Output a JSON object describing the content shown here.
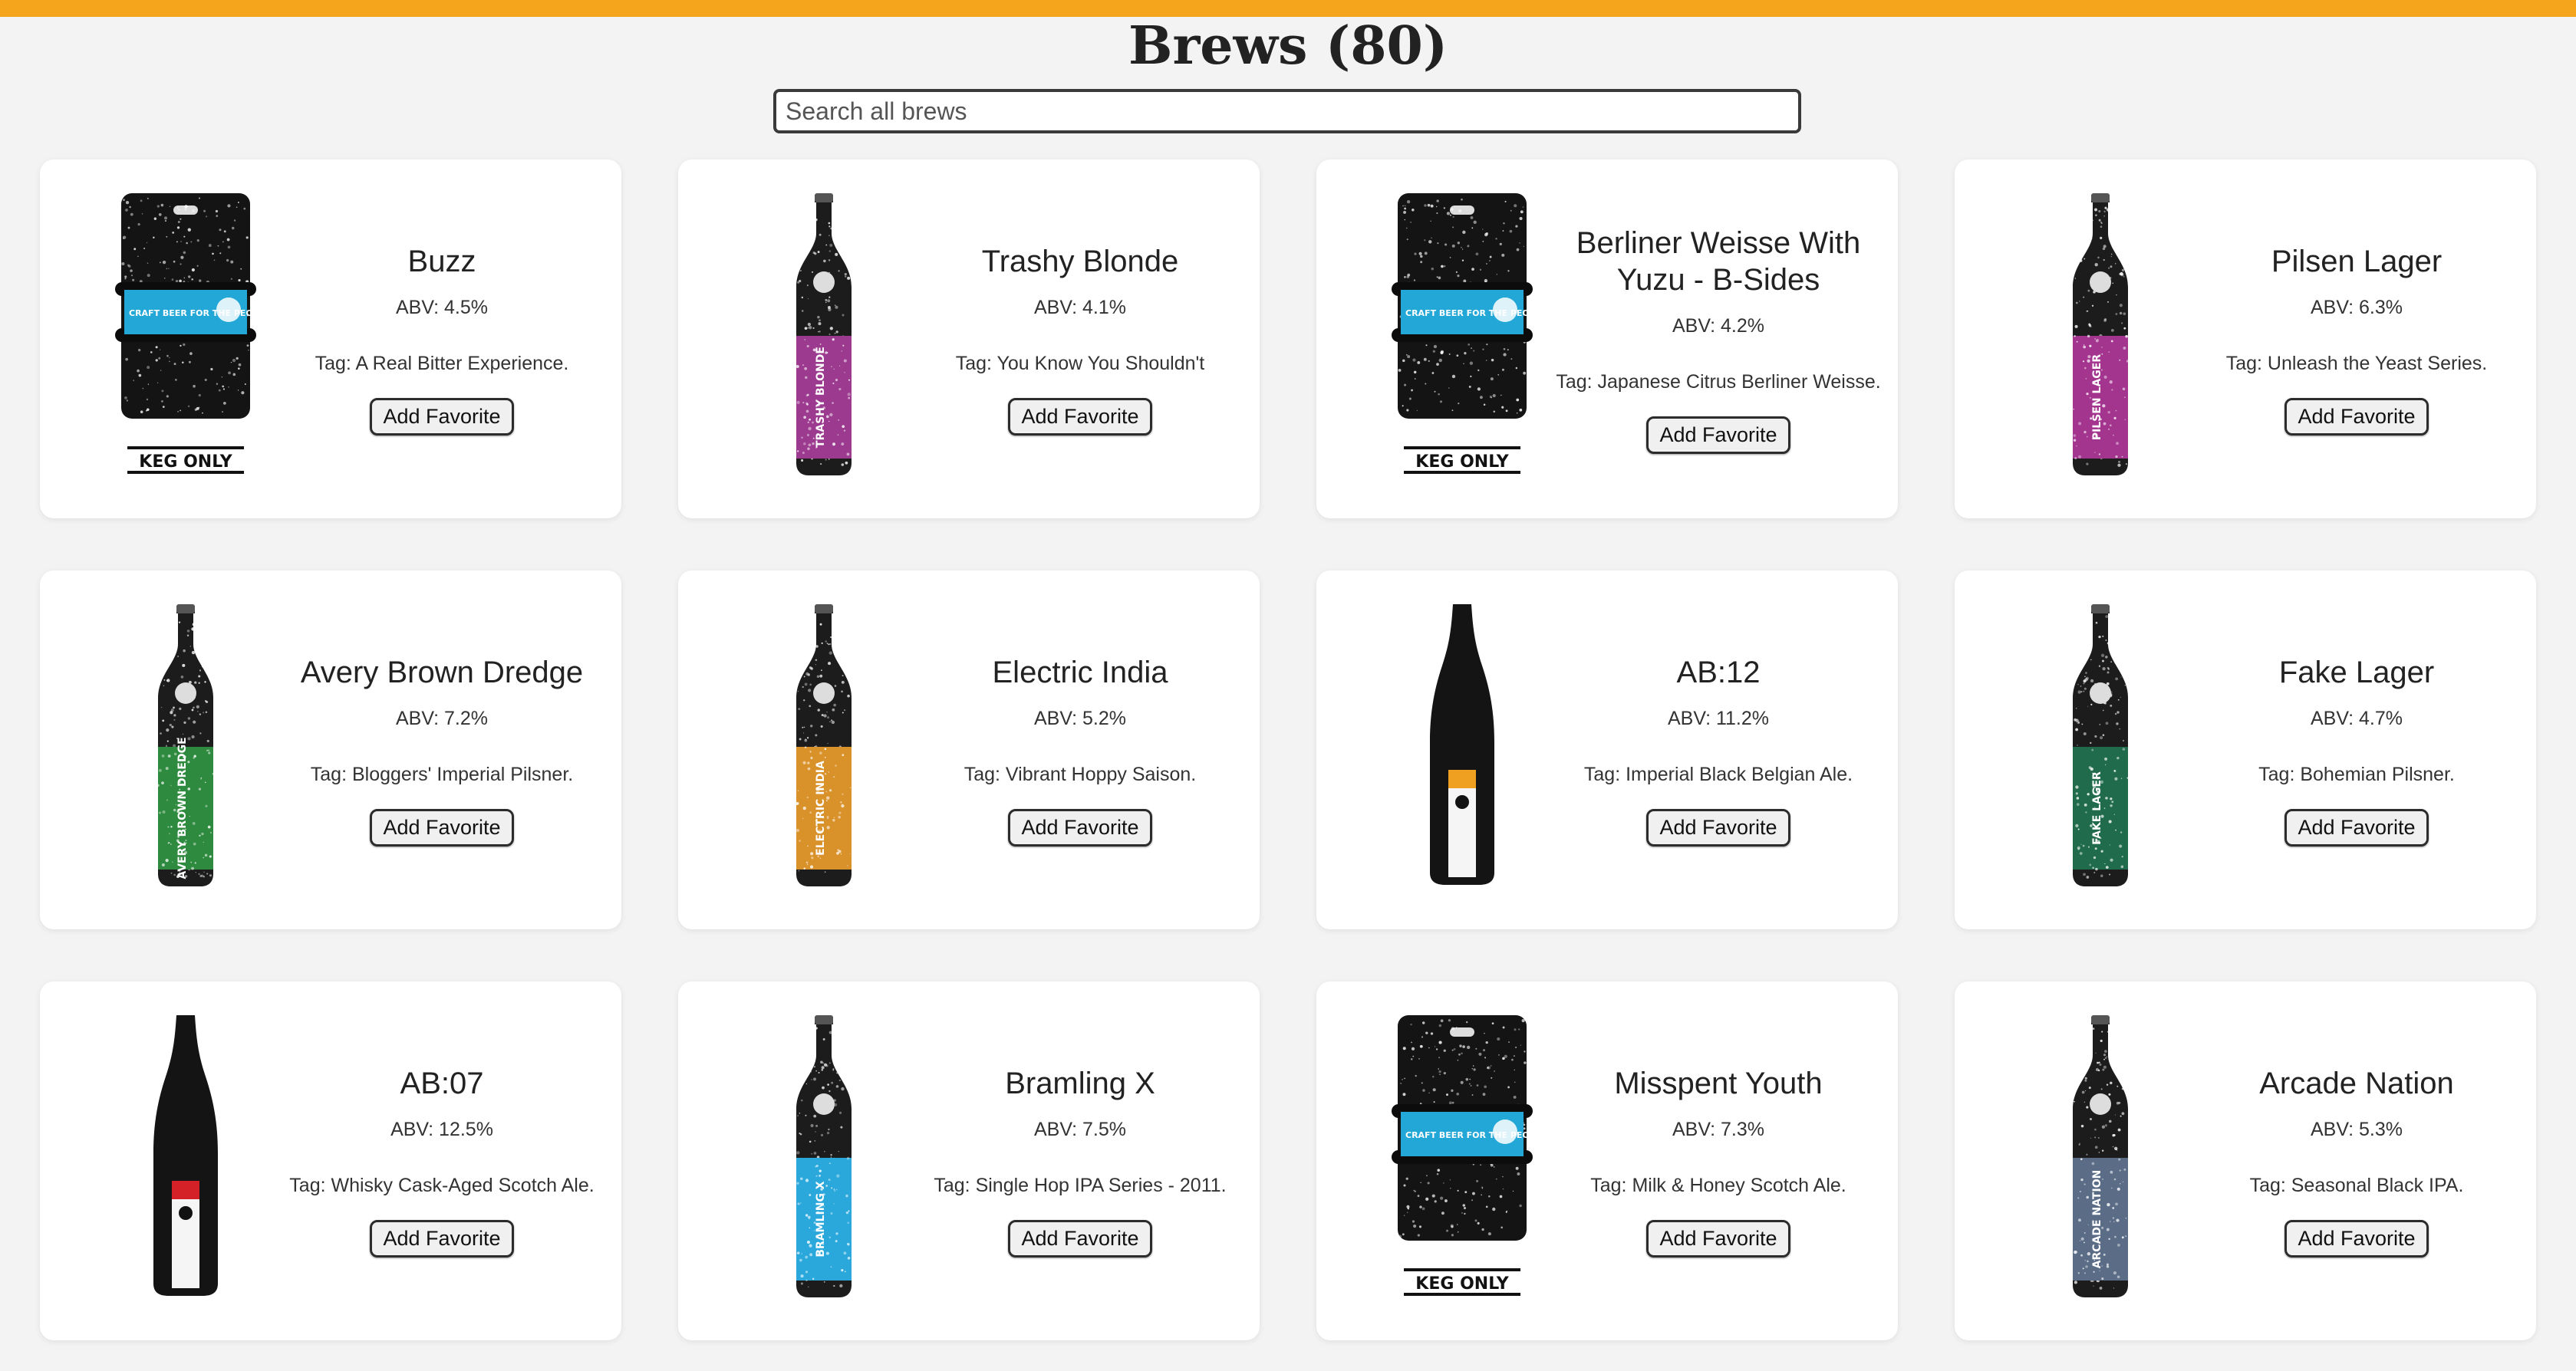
{
  "page": {
    "title": "Brews (80)"
  },
  "search": {
    "placeholder": "Search all brews"
  },
  "button_label": "Add Favorite",
  "colors": {
    "accent": "#f4a51c",
    "card": "#ffffff",
    "background": "#f3f3f3"
  },
  "brews": [
    {
      "name": "Buzz",
      "abv": "ABV: 4.5%",
      "tag": "Tag: A Real Bitter Experience.",
      "image": "keg",
      "label_color": "#22a7d6",
      "keg_banner": "KEG ONLY",
      "keg_text": "CRAFT BEER FOR THE PEOPLE"
    },
    {
      "name": "Trashy Blonde",
      "abv": "ABV: 4.1%",
      "tag": "Tag: You Know You Shouldn't",
      "image": "bottle",
      "label_color": "#9b3a8e",
      "label_text": "TRASHY BLONDE"
    },
    {
      "name": "Berliner Weisse With Yuzu - B-Sides",
      "abv": "ABV: 4.2%",
      "tag": "Tag: Japanese Citrus Berliner Weisse.",
      "image": "keg",
      "label_color": "#22a7d6",
      "keg_banner": "KEG ONLY",
      "keg_text": "CRAFT BEER FOR THE PEOPLE"
    },
    {
      "name": "Pilsen Lager",
      "abv": "ABV: 6.3%",
      "tag": "Tag: Unleash the Yeast Series.",
      "image": "bottle",
      "label_color": "#a3358f",
      "label_text": "PILSEN LAGER"
    },
    {
      "name": "Avery Brown Dredge",
      "abv": "ABV: 7.2%",
      "tag": "Tag: Bloggers' Imperial Pilsner.",
      "image": "bottle",
      "label_color": "#2e8a3e",
      "label_text": "AVERY BROWN DREDGE"
    },
    {
      "name": "Electric India",
      "abv": "ABV: 5.2%",
      "tag": "Tag: Vibrant Hoppy Saison.",
      "image": "bottle",
      "label_color": "#d9912a",
      "label_text": "ELECTRIC INDIA"
    },
    {
      "name": "AB:12",
      "abv": "ABV: 11.2%",
      "tag": "Tag: Imperial Black Belgian Ale.",
      "image": "tall",
      "label_color": "#f0a020"
    },
    {
      "name": "Fake Lager",
      "abv": "ABV: 4.7%",
      "tag": "Tag: Bohemian Pilsner.",
      "image": "bottle",
      "label_color": "#1f6b4c",
      "label_text": "FAKE LAGER"
    },
    {
      "name": "AB:07",
      "abv": "ABV: 12.5%",
      "tag": "Tag: Whisky Cask-Aged Scotch Ale.",
      "image": "tall",
      "label_color": "#d42027"
    },
    {
      "name": "Bramling X",
      "abv": "ABV: 7.5%",
      "tag": "Tag: Single Hop IPA Series - 2011.",
      "image": "bottle",
      "label_color": "#2aa8dc",
      "label_text": "BRAMLING X"
    },
    {
      "name": "Misspent Youth",
      "abv": "ABV: 7.3%",
      "tag": "Tag: Milk & Honey Scotch Ale.",
      "image": "keg",
      "label_color": "#22a7d6",
      "keg_banner": "KEG ONLY",
      "keg_text": "CRAFT BEER FOR THE PEOPLE"
    },
    {
      "name": "Arcade Nation",
      "abv": "ABV: 5.3%",
      "tag": "Tag: Seasonal Black IPA.",
      "image": "bottle",
      "label_color": "#5a6c86",
      "label_text": "ARCADE NATION"
    }
  ]
}
